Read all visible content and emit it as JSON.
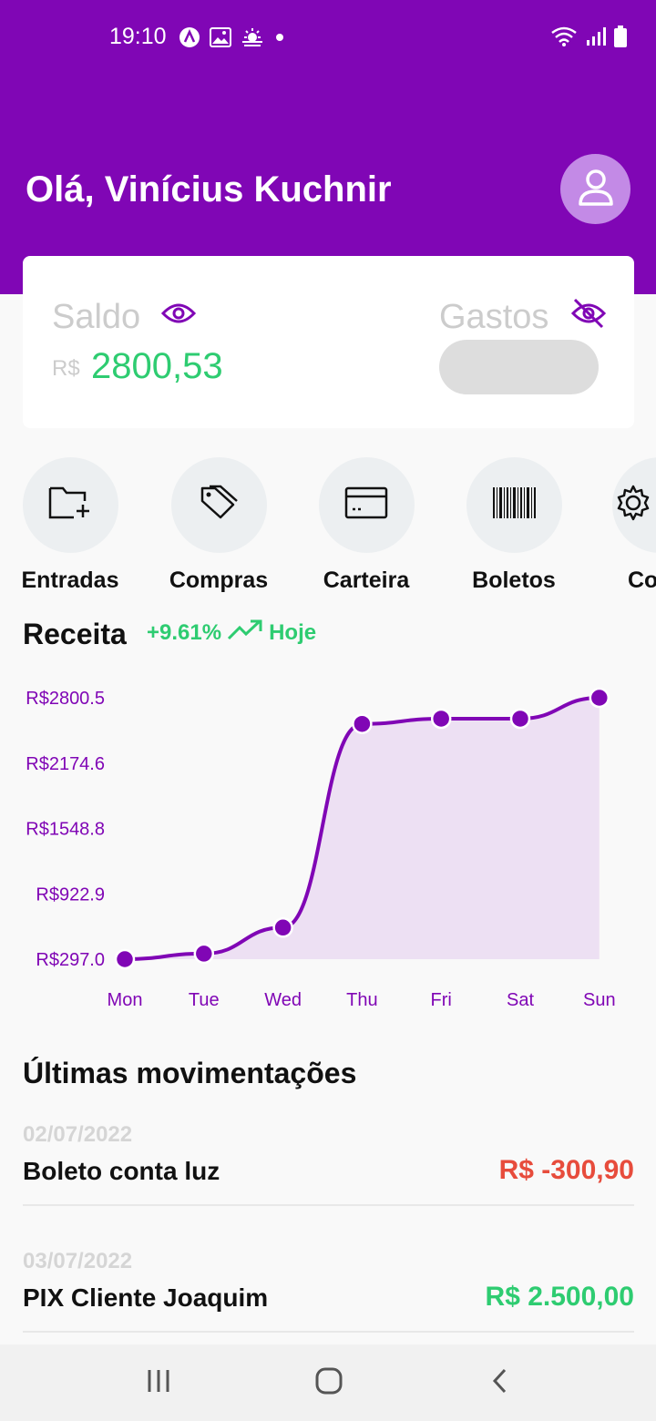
{
  "status_bar": {
    "time": "19:10",
    "icons_left": [
      "anydesk-icon",
      "gallery-icon",
      "weather-icon",
      "dot-icon"
    ],
    "icons_right": [
      "wifi-icon",
      "signal-icon",
      "battery-icon"
    ]
  },
  "header": {
    "greeting": "Olá, Vinícius Kuchnir",
    "avatar_icon": "user-icon"
  },
  "balance": {
    "saldo_label": "Saldo",
    "currency": "R$",
    "saldo_value": "2800,53",
    "gastos_label": "Gastos"
  },
  "shortcuts": [
    {
      "label": "Entradas",
      "icon": "folder-plus-icon"
    },
    {
      "label": "Compras",
      "icon": "tag-icon"
    },
    {
      "label": "Carteira",
      "icon": "credit-card-icon"
    },
    {
      "label": "Boletos",
      "icon": "barcode-icon"
    },
    {
      "label": "Co",
      "icon": "gear-icon"
    }
  ],
  "receita": {
    "title": "Receita",
    "change": "+9.61%",
    "period": "Hoje"
  },
  "chart_data": {
    "type": "area",
    "categories": [
      "Mon",
      "Tue",
      "Wed",
      "Thu",
      "Fri",
      "Sat",
      "Sun"
    ],
    "series": [
      {
        "values": [
          297.0,
          350,
          600,
          2550,
          2600,
          2600,
          2800.5
        ]
      }
    ],
    "y_ticks": [
      "R$2800.5",
      "R$2174.6",
      "R$1548.8",
      "R$922.9",
      "R$297.0"
    ],
    "ylim": [
      297.0,
      2800.5
    ],
    "color": "#8006b5",
    "fill": "#ede0f3"
  },
  "movements": {
    "title": "Últimas movimentações",
    "items": [
      {
        "date": "02/07/2022",
        "description": "Boleto conta luz",
        "amount": "R$ -300,90",
        "color": "#e74c3c"
      },
      {
        "date": "03/07/2022",
        "description": "PIX Cliente Joaquim",
        "amount": "R$ 2.500,00",
        "color": "#2ecc71"
      }
    ]
  },
  "nav": {
    "buttons": [
      "recents-icon",
      "home-icon",
      "back-icon"
    ]
  }
}
